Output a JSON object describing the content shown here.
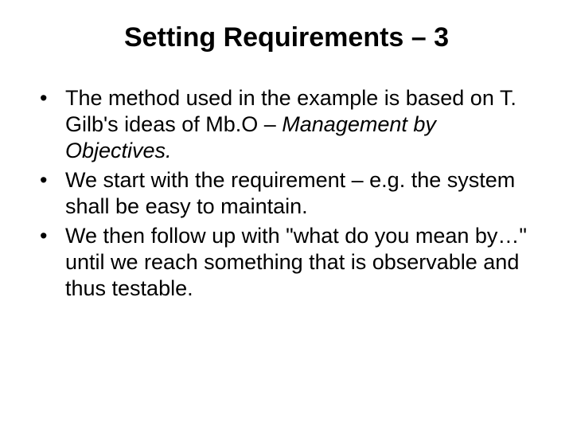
{
  "title": "Setting Requirements – 3",
  "bullets": [
    {
      "pre": "The method used in the example is based on T. Gilb's ideas of Mb.O – ",
      "em": "Management by Objectives.",
      "post": ""
    },
    {
      "pre": "We start with the requirement – e.g. the system shall be easy to maintain.",
      "em": "",
      "post": ""
    },
    {
      "pre": "We then follow up with \"what do you mean by…\" until we reach something that is observable and thus testable.",
      "em": "",
      "post": ""
    }
  ]
}
